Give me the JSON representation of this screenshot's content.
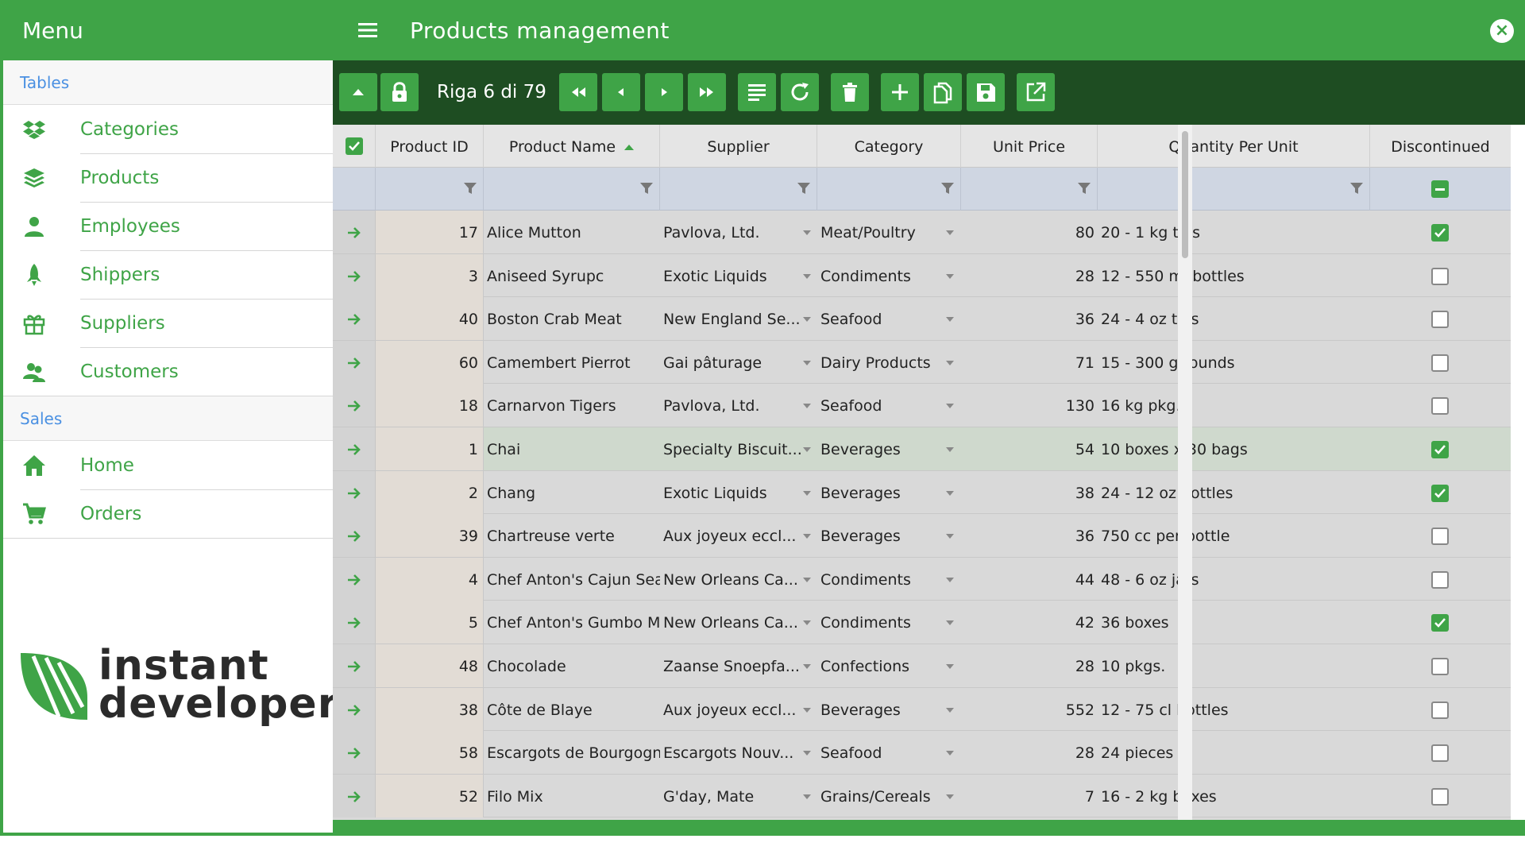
{
  "sidebar": {
    "header": "Menu",
    "section_tables": "Tables",
    "section_sales": "Sales",
    "table_items": [
      {
        "label": "Categories",
        "icon": "dropbox-icon"
      },
      {
        "label": "Products",
        "icon": "layers-icon"
      },
      {
        "label": "Employees",
        "icon": "person-icon"
      },
      {
        "label": "Shippers",
        "icon": "rocket-icon"
      },
      {
        "label": "Suppliers",
        "icon": "gift-icon"
      },
      {
        "label": "Customers",
        "icon": "people-icon"
      }
    ],
    "sales_items": [
      {
        "label": "Home",
        "icon": "home-icon"
      },
      {
        "label": "Orders",
        "icon": "cart-icon"
      }
    ],
    "logo": {
      "line1": "instant",
      "line2": "developer"
    }
  },
  "topbar": {
    "title": "Products management"
  },
  "toolbar": {
    "record_counter": "Riga 6 di 79"
  },
  "grid": {
    "columns": [
      "Product ID",
      "Product Name",
      "Supplier",
      "Category",
      "Unit Price",
      "Quantity Per Unit",
      "Discontinued"
    ],
    "sorted_column": "Product Name",
    "selected_index": 5,
    "rows": [
      {
        "id": "17",
        "name": "Alice Mutton",
        "supplier": "Pavlova, Ltd.",
        "category": "Meat/Poultry",
        "price": "80",
        "qty": "20 - 1 kg tins",
        "discontinued": true
      },
      {
        "id": "3",
        "name": "Aniseed Syrupc",
        "supplier": "Exotic Liquids",
        "category": "Condiments",
        "price": "28",
        "qty": "12 - 550 ml bottles",
        "discontinued": false
      },
      {
        "id": "40",
        "name": "Boston Crab Meat",
        "supplier": "New England Se...",
        "category": "Seafood",
        "price": "36",
        "qty": "24 - 4 oz tins",
        "discontinued": false
      },
      {
        "id": "60",
        "name": "Camembert Pierrot",
        "supplier": "Gai pâturage",
        "category": "Dairy Products",
        "price": "71",
        "qty": "15 - 300 g rounds",
        "discontinued": false
      },
      {
        "id": "18",
        "name": "Carnarvon Tigers",
        "supplier": "Pavlova, Ltd.",
        "category": "Seafood",
        "price": "130",
        "qty": "16 kg pkg.",
        "discontinued": false
      },
      {
        "id": "1",
        "name": "Chai",
        "supplier": "Specialty Biscuit...",
        "category": "Beverages",
        "price": "54",
        "qty": "10 boxes x 30 bags",
        "discontinued": true
      },
      {
        "id": "2",
        "name": "Chang",
        "supplier": "Exotic Liquids",
        "category": "Beverages",
        "price": "38",
        "qty": "24 - 12 oz bottles",
        "discontinued": true
      },
      {
        "id": "39",
        "name": "Chartreuse verte",
        "supplier": "Aux joyeux eccl...",
        "category": "Beverages",
        "price": "36",
        "qty": "750 cc per bottle",
        "discontinued": false
      },
      {
        "id": "4",
        "name": "Chef Anton's Cajun Sea:",
        "supplier": "New Orleans Ca...",
        "category": "Condiments",
        "price": "44",
        "qty": "48 - 6 oz jars",
        "discontinued": false
      },
      {
        "id": "5",
        "name": "Chef Anton's Gumbo Mi:",
        "supplier": "New Orleans Ca...",
        "category": "Condiments",
        "price": "42",
        "qty": "36 boxes",
        "discontinued": true
      },
      {
        "id": "48",
        "name": "Chocolade",
        "supplier": "Zaanse Snoepfa...",
        "category": "Confections",
        "price": "28",
        "qty": "10 pkgs.",
        "discontinued": false
      },
      {
        "id": "38",
        "name": "Côte de Blaye",
        "supplier": "Aux joyeux eccl...",
        "category": "Beverages",
        "price": "552",
        "qty": "12 - 75 cl bottles",
        "discontinued": false
      },
      {
        "id": "58",
        "name": "Escargots de Bourgogne",
        "supplier": "Escargots Nouv...",
        "category": "Seafood",
        "price": "28",
        "qty": "24 pieces",
        "discontinued": false
      },
      {
        "id": "52",
        "name": "Filo Mix",
        "supplier": "G'day, Mate",
        "category": "Grains/Cereals",
        "price": "7",
        "qty": "16 - 2 kg boxes",
        "discontinued": false
      }
    ]
  },
  "colors": {
    "brand_green": "#3fa447",
    "toolbar_dark": "#1e4d22",
    "link_blue": "#4a90e2"
  }
}
